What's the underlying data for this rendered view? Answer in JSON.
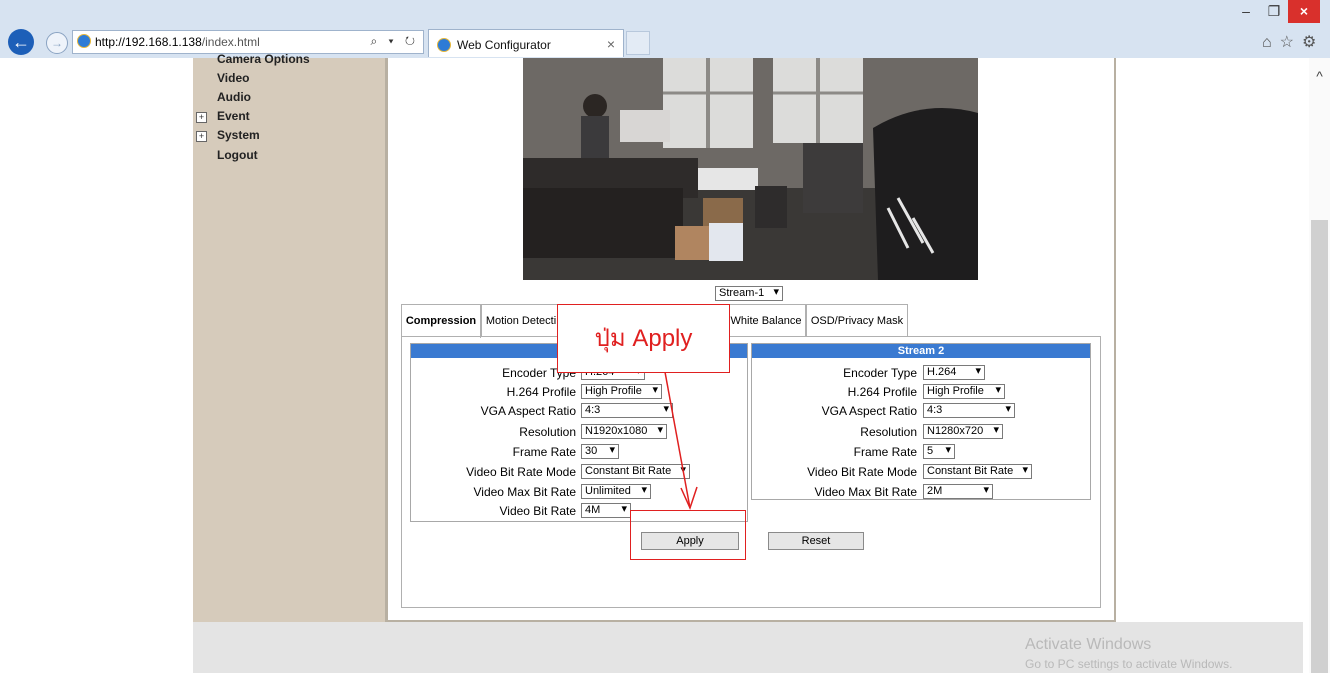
{
  "browser": {
    "url_host": "http://192.168.1.138",
    "url_path": "/index.html",
    "address_tools": "⌕ ▾ ↻",
    "tab_title": "Web Configurator",
    "tab_close": "×",
    "window_controls": {
      "minimize": "–",
      "maximize": "❐",
      "close": "×"
    },
    "icons": [
      "home-icon",
      "favorites-star-icon",
      "settings-gear-icon"
    ]
  },
  "sidebar": {
    "items": [
      {
        "label": "Camera Options",
        "expandable": false
      },
      {
        "label": "Video",
        "expandable": false
      },
      {
        "label": "Audio",
        "expandable": false
      },
      {
        "label": "Event",
        "expandable": true
      },
      {
        "label": "System",
        "expandable": true
      },
      {
        "label": "Logout",
        "expandable": false
      }
    ],
    "expand_symbol": "+"
  },
  "preview": {
    "stream_select": "Stream-1"
  },
  "tabs": [
    {
      "label": "Compression",
      "active": true
    },
    {
      "label": "Motion Detecti",
      "active": false
    },
    {
      "label": "White Balance",
      "active": false
    },
    {
      "label": "OSD/Privacy Mask",
      "active": false
    }
  ],
  "stream1": {
    "title": "",
    "rows": [
      {
        "label": "Encoder Type",
        "value": "H.264"
      },
      {
        "label": "H.264 Profile",
        "value": "High Profile"
      },
      {
        "label": "VGA Aspect Ratio",
        "value": "4:3"
      },
      {
        "label": "Resolution",
        "value": "N1920x1080"
      },
      {
        "label": "Frame Rate",
        "value": "30"
      },
      {
        "label": "Video Bit Rate Mode",
        "value": "Constant Bit Rate"
      },
      {
        "label": "Video Max Bit Rate",
        "value": "Unlimited"
      },
      {
        "label": "Video Bit Rate",
        "value": "4M"
      }
    ]
  },
  "stream2": {
    "title": "Stream 2",
    "rows": [
      {
        "label": "Encoder Type",
        "value": "H.264"
      },
      {
        "label": "H.264 Profile",
        "value": "High Profile"
      },
      {
        "label": "VGA Aspect Ratio",
        "value": "4:3"
      },
      {
        "label": "Resolution",
        "value": "N1280x720"
      },
      {
        "label": "Frame Rate",
        "value": "5"
      },
      {
        "label": "Video Bit Rate Mode",
        "value": "Constant Bit Rate"
      },
      {
        "label": "Video Max Bit Rate",
        "value": "2M"
      }
    ]
  },
  "buttons": {
    "apply": "Apply",
    "reset": "Reset"
  },
  "annotation": {
    "label": "ปุ่ม Apply",
    "color": "#e02020"
  },
  "watermark": {
    "line1": "Activate Windows",
    "line2": "Go to PC settings to activate Windows."
  },
  "colors": {
    "accent_blue": "#3a7ad1",
    "sidebar_bg": "#d6cbbb",
    "chrome_bg": "#d7e3f1"
  }
}
